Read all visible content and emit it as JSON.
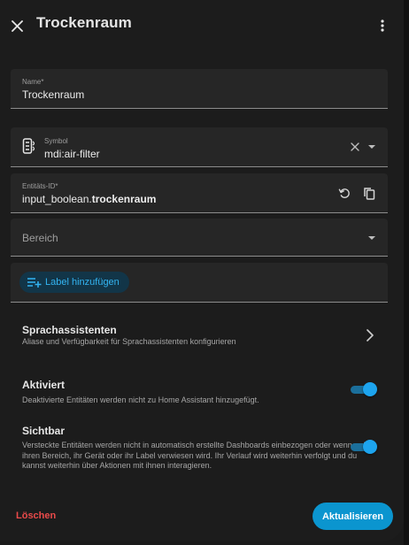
{
  "dialog": {
    "title": "Trockenraum",
    "close_icon": "close-icon",
    "more_icon": "more-vert-icon"
  },
  "name_field": {
    "label": "Name*",
    "value": "Trockenraum"
  },
  "symbol_field": {
    "label": "Symbol",
    "value": "mdi:air-filter",
    "icon": "air-filter-icon"
  },
  "entity_id_field": {
    "label": "Entitäts-ID*",
    "prefix": "input_boolean.",
    "value": "trockenraum"
  },
  "area_field": {
    "placeholder": "Bereich"
  },
  "labels": {
    "add_label": "Label hinzufügen"
  },
  "voice_assistants": {
    "title": "Sprachassistenten",
    "description": "Aliase und Verfügbarkeit für Sprachassistenten konfigurieren"
  },
  "enabled": {
    "title": "Aktiviert",
    "description": "Deaktivierte Entitäten werden nicht zu Home Assistant hinzugefügt.",
    "checked": true
  },
  "visible": {
    "title": "Sichtbar",
    "description": "Versteckte Entitäten werden nicht in automatisch erstellte Dashboards einbezogen oder wenn auf ihren Bereich, ihr Gerät oder ihr Label verwiesen wird. Ihr Verlauf wird weiterhin verfolgt und du kannst weiterhin über Aktionen mit ihnen interagieren.",
    "checked": true
  },
  "actions": {
    "delete": "Löschen",
    "update": "Aktualisieren"
  },
  "colors": {
    "accent": "#0b95cf",
    "danger": "#ea4a4a",
    "surface": "#1c1c1c",
    "field": "#262626"
  }
}
